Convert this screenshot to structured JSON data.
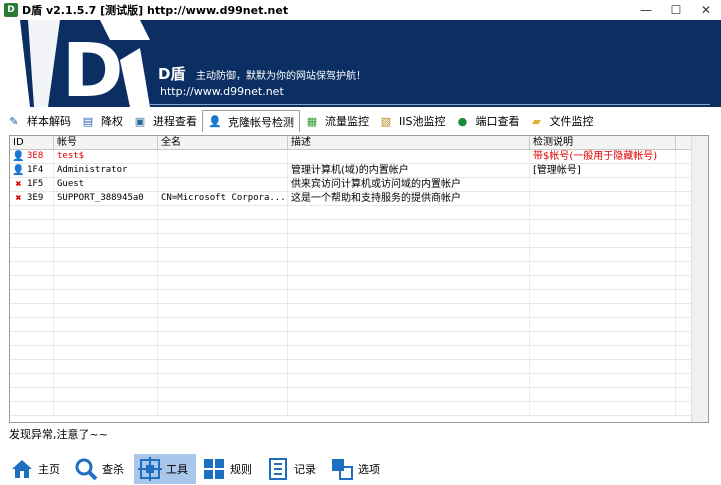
{
  "window": {
    "title": "D盾 v2.1.5.7 [测试版] http://www.d99net.net",
    "app_icon_text": "D"
  },
  "banner": {
    "brand": "D盾",
    "slogan": "主动防御，默默为你的网站保驾护航！",
    "url": "http://www.d99net.net",
    "logo_letter": "D"
  },
  "tabs": [
    {
      "label": "样本解码",
      "icon": "pen-icon"
    },
    {
      "label": "降权",
      "icon": "document-icon"
    },
    {
      "label": "进程查看",
      "icon": "window-icon"
    },
    {
      "label": "克隆帐号检测",
      "icon": "user-icon",
      "active": true
    },
    {
      "label": "流量监控",
      "icon": "chart-icon"
    },
    {
      "label": "IIS池监控",
      "icon": "pool-icon"
    },
    {
      "label": "端口查看",
      "icon": "globe-icon"
    },
    {
      "label": "文件监控",
      "icon": "folder-icon"
    }
  ],
  "table": {
    "headers": [
      "ID",
      "帐号",
      "全名",
      "描述",
      "检测说明"
    ],
    "rows": [
      {
        "icon": "user-icon",
        "id": "3E8",
        "account": "test$",
        "fullname": "",
        "desc": "",
        "note": "带$帐号(一般用于隐藏帐号)",
        "red": true
      },
      {
        "icon": "user-icon",
        "id": "1F4",
        "account": "Administrator",
        "fullname": "",
        "desc": "管理计算机(域)的内置帐户",
        "note": "[管理帐号]",
        "red": false
      },
      {
        "icon": "disabled-x-icon",
        "id": "1F5",
        "account": "Guest",
        "fullname": "",
        "desc": "供来宾访问计算机或访问域的内置帐户",
        "note": "",
        "red": false
      },
      {
        "icon": "disabled-x-icon",
        "id": "3E9",
        "account": "SUPPORT_388945a0",
        "fullname": "CN=Microsoft Corpora...",
        "desc": "这是一个帮助和支持服务的提供商帐户",
        "note": "",
        "red": false
      }
    ]
  },
  "status": "发现异常,注意了~~",
  "bottom": [
    {
      "label": "主页",
      "icon": "home-icon"
    },
    {
      "label": "查杀",
      "icon": "search-icon"
    },
    {
      "label": "工具",
      "icon": "tools-icon",
      "active": true
    },
    {
      "label": "规则",
      "icon": "grid-icon"
    },
    {
      "label": "记录",
      "icon": "log-icon"
    },
    {
      "label": "选项",
      "icon": "options-icon"
    }
  ],
  "colors": {
    "banner": "#0b2f63",
    "accent": "#a9c7ea",
    "warning": "#e00000"
  }
}
